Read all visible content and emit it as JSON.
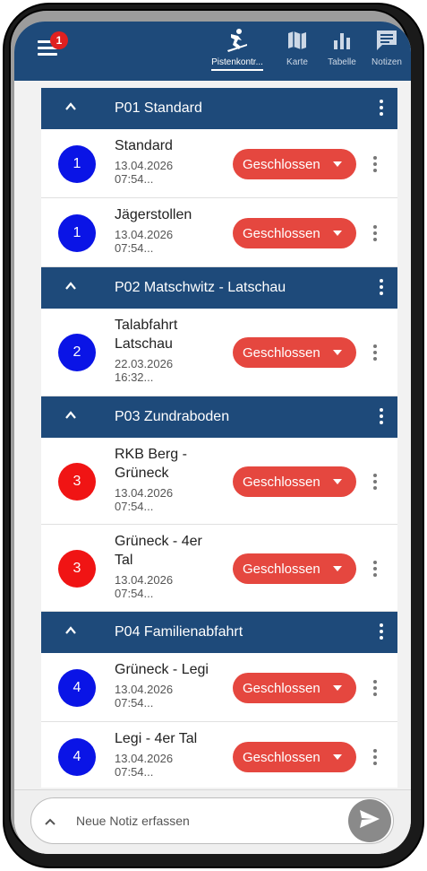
{
  "appbar": {
    "badge_count": "1",
    "tabs": [
      {
        "label": "Pistenkontr...",
        "icon": "skier-icon",
        "active": true
      },
      {
        "label": "Karte",
        "icon": "map-icon",
        "active": false
      },
      {
        "label": "Tabelle",
        "icon": "bar-chart-icon",
        "active": false
      },
      {
        "label": "Notizen",
        "icon": "notes-icon",
        "active": false
      }
    ]
  },
  "groups": [
    {
      "title": "P01 Standard",
      "items": [
        {
          "number": "1",
          "name": "Standard",
          "date": "13.04.2026",
          "time": "07:54...",
          "status": "Geschlossen"
        },
        {
          "number": "1",
          "name": "Jägerstollen",
          "date": "13.04.2026",
          "time": "07:54...",
          "status": "Geschlossen"
        }
      ]
    },
    {
      "title": "P02 Matschwitz - Latschau",
      "items": [
        {
          "number": "2",
          "name": "Talabfahrt Latschau",
          "date": "22.03.2026",
          "time": "16:32...",
          "status": "Geschlossen"
        }
      ]
    },
    {
      "title": "P03 Zundraboden",
      "items": [
        {
          "number": "3",
          "name": "RKB Berg - Grüneck",
          "date": "13.04.2026",
          "time": "07:54...",
          "status": "Geschlossen"
        },
        {
          "number": "3",
          "name": "Grüneck - 4er Tal",
          "date": "13.04.2026",
          "time": "07:54...",
          "status": "Geschlossen"
        }
      ]
    },
    {
      "title": "P04 Familienabfahrt",
      "items": [
        {
          "number": "4",
          "name": "Grüneck - Legi",
          "date": "13.04.2026",
          "time": "07:54...",
          "status": "Geschlossen"
        },
        {
          "number": "4",
          "name": "Legi - 4er Tal",
          "date": "13.04.2026",
          "time": "07:54...",
          "status": "Geschlossen"
        }
      ]
    }
  ],
  "notebar": {
    "placeholder": "Neue Notiz erfassen"
  },
  "colors": {
    "primary": "#1e4a7a",
    "status_closed": "#e5473f",
    "difficulty_blue": "#0a14e6",
    "difficulty_red": "#f01414",
    "send_button": "#8a8a8a"
  }
}
